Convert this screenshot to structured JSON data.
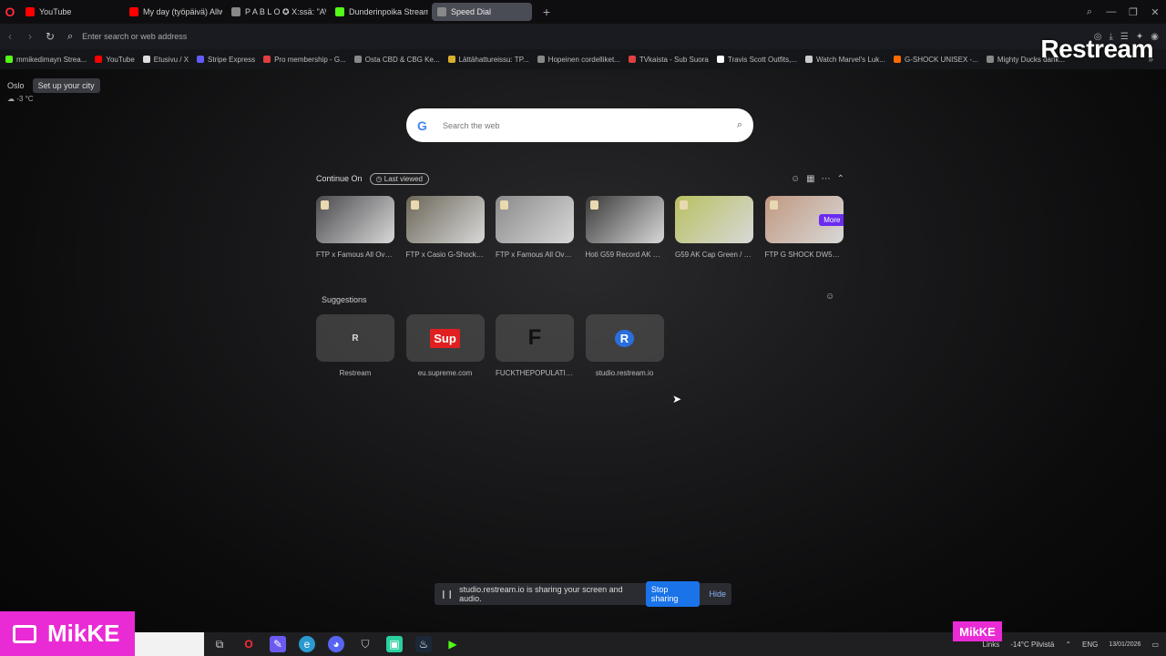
{
  "tabs": [
    {
      "label": "YouTube",
      "color": "#ff0000",
      "active": false
    },
    {
      "label": "My day (työpäivä) Allwat",
      "color": "#ff0000",
      "active": false
    },
    {
      "label": "P A B L O ✪ X:ssä: \"AVERA",
      "color": "#888888",
      "active": false
    },
    {
      "label": "Dunderinpoika Stream - Y",
      "color": "#53fc18",
      "active": false
    },
    {
      "label": "Speed Dial",
      "color": "#888888",
      "active": true
    }
  ],
  "address": {
    "placeholder": "Enter search or web address"
  },
  "bookmarks": [
    {
      "label": "mmikedimayn Strea...",
      "color": "#53fc18"
    },
    {
      "label": "YouTube",
      "color": "#ff0000"
    },
    {
      "label": "Etusivu / X",
      "color": "#dddddd"
    },
    {
      "label": "Stripe Express",
      "color": "#635bff"
    },
    {
      "label": "Pro membership - G...",
      "color": "#e04040"
    },
    {
      "label": "Osta CBD & CBG Ke...",
      "color": "#888888"
    },
    {
      "label": "Lättähattureissu: TP...",
      "color": "#d8b030"
    },
    {
      "label": "Hopeinen cordelliket...",
      "color": "#888888"
    },
    {
      "label": "TVkaista - Sub Suora",
      "color": "#e04040"
    },
    {
      "label": "Travis Scott Outfits,...",
      "color": "#ffffff"
    },
    {
      "label": "Watch Marvel's Luk...",
      "color": "#cccccc"
    },
    {
      "label": "G-SHOCK UNISEX -...",
      "color": "#ff6a00"
    },
    {
      "label": "Mighty Ducks dank...",
      "color": "#888888"
    }
  ],
  "overlay": {
    "brand": "Restream"
  },
  "weather": {
    "city": "Oslo",
    "setup": "Set up your city",
    "temp": "-3 °C"
  },
  "search": {
    "g": "G",
    "placeholder": "Search the web"
  },
  "continue_on": {
    "title": "Continue On",
    "filter": "Last viewed",
    "more_label": "More",
    "items": [
      {
        "label": "FTP x Famous All Over...",
        "color": "#4a4a4e"
      },
      {
        "label": "FTP x Casio G-Shock G...",
        "color": "#6b6658"
      },
      {
        "label": "FTP x Famous All Over...",
        "color": "#8a8a8a"
      },
      {
        "label": "Hoti G59 Record AK Lo...",
        "color": "#3a3a3a"
      },
      {
        "label": "G59 AK Cap Green / Bl...",
        "color": "#b8c060"
      },
      {
        "label": "FTP G SHOCK DW5600...",
        "color": "#c09880"
      }
    ]
  },
  "suggestions": {
    "title": "Suggestions",
    "items": [
      {
        "label": "Restream",
        "glyph": "R",
        "glyph_color": "#dddddd",
        "bg": "transparent"
      },
      {
        "label": "eu.supreme.com",
        "glyph": "Sup",
        "glyph_color": "#ffffff",
        "bg": "#e02020"
      },
      {
        "label": "FUCKTHEPOPULATIO...",
        "glyph": "F",
        "glyph_color": "#111111",
        "bg": "transparent"
      },
      {
        "label": "studio.restream.io",
        "glyph": "R",
        "glyph_color": "#ffffff",
        "bg": "#2a6fe0"
      }
    ]
  },
  "share_bar": {
    "message": "studio.restream.io is sharing your screen and audio.",
    "stop": "Stop sharing",
    "hide": "Hide"
  },
  "taskbar": {
    "links": "Links",
    "weather": "-14°C Pilvistä",
    "lang": "ENG",
    "date": "13/01/2026"
  },
  "streamer": {
    "name": "MikKE",
    "name_small": "MikKE"
  }
}
